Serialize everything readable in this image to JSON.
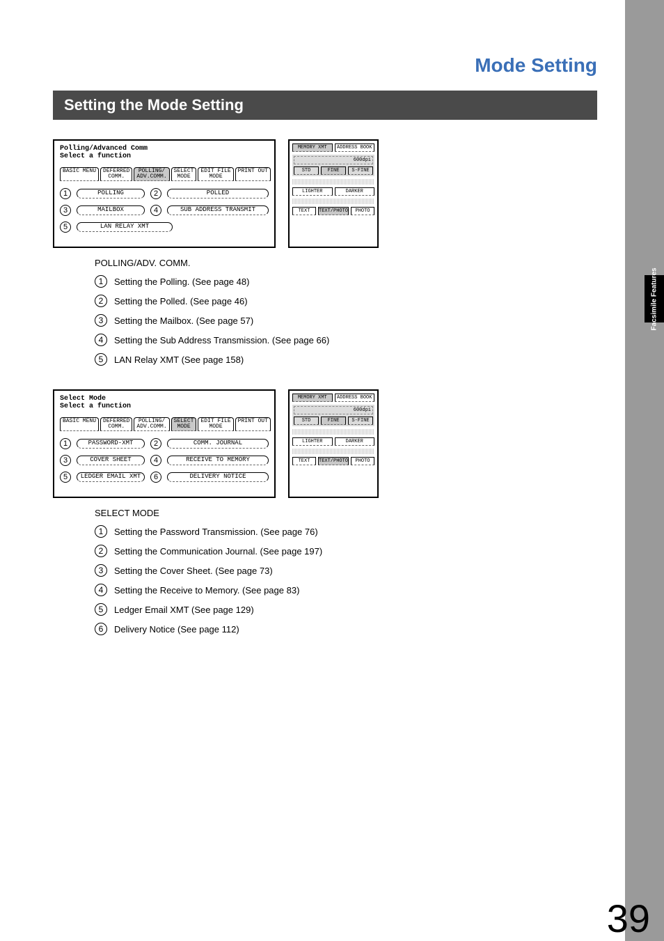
{
  "chapter": "Mode Setting",
  "section": "Setting the Mode Setting",
  "side_tab": "Facsimile\nFeatures",
  "page_number": "39",
  "panel1": {
    "title_line1": "Polling/Advanced Comm",
    "title_line2": "Select a function",
    "tabs": [
      "BASIC MENU",
      "DEFERRED\nCOMM.",
      "POLLING/\nADV.COMM.",
      "SELECT\nMODE",
      "EDIT FILE\nMODE",
      "PRINT OUT"
    ],
    "active_tab_index": 2,
    "rows": [
      {
        "n": "1",
        "a": "POLLING",
        "m": "2",
        "b": "POLLED"
      },
      {
        "n": "3",
        "a": "MAILBOX",
        "m": "4",
        "b": "SUB ADDRESS TRANSMIT"
      },
      {
        "n": "5",
        "a": "LAN RELAY XMT"
      }
    ]
  },
  "desc1": {
    "heading": "POLLING/ADV. COMM.",
    "items": [
      {
        "n": "1",
        "text": "Setting the Polling. (See page 48)"
      },
      {
        "n": "2",
        "text": "Setting the Polled. (See page 46)"
      },
      {
        "n": "3",
        "text": "Setting the Mailbox. (See page 57)"
      },
      {
        "n": "4",
        "text": "Setting the Sub Address Transmission. (See page 66)"
      },
      {
        "n": "5",
        "text": "LAN Relay XMT (See page 158)"
      }
    ]
  },
  "panel2": {
    "title_line1": "Select Mode",
    "title_line2": "Select a function",
    "tabs": [
      "BASIC MENU",
      "DEFERRED\nCOMM.",
      "POLLING/\nADV.COMM.",
      "SELECT\nMODE",
      "EDIT FILE\nMODE",
      "PRINT OUT"
    ],
    "active_tab_index": 3,
    "rows": [
      {
        "n": "1",
        "a": "PASSWORD-XMT",
        "m": "2",
        "b": "COMM. JOURNAL"
      },
      {
        "n": "3",
        "a": "COVER SHEET",
        "m": "4",
        "b": "RECEIVE TO MEMORY"
      },
      {
        "n": "5",
        "a": "LEDGER EMAIL XMT",
        "m": "6",
        "b": "DELIVERY NOTICE"
      }
    ]
  },
  "desc2": {
    "heading": "SELECT MODE",
    "items": [
      {
        "n": "1",
        "text": "Setting the Password Transmission. (See page 76)"
      },
      {
        "n": "2",
        "text": "Setting the Communication Journal. (See page 197)"
      },
      {
        "n": "3",
        "text": "Setting the Cover Sheet. (See page 73)"
      },
      {
        "n": "4",
        "text": "Setting the Receive to Memory. (See page 83)"
      },
      {
        "n": "5",
        "text": "Ledger Email XMT (See page 129)"
      },
      {
        "n": "6",
        "text": "Delivery Notice (See page 112)"
      }
    ]
  },
  "side_panel": {
    "top_row": [
      "MEMORY XMT",
      "ADDRESS BOOK"
    ],
    "dpi": "600dpi",
    "res_row": [
      "STD",
      "FINE",
      "S-FINE"
    ],
    "res_active_index": 1,
    "density_row": [
      "LIGHTER",
      "DARKER"
    ],
    "quality_row": [
      "TEXT",
      "TEXT/PHOTO",
      "PHOTO"
    ],
    "quality_active_index": 1
  }
}
